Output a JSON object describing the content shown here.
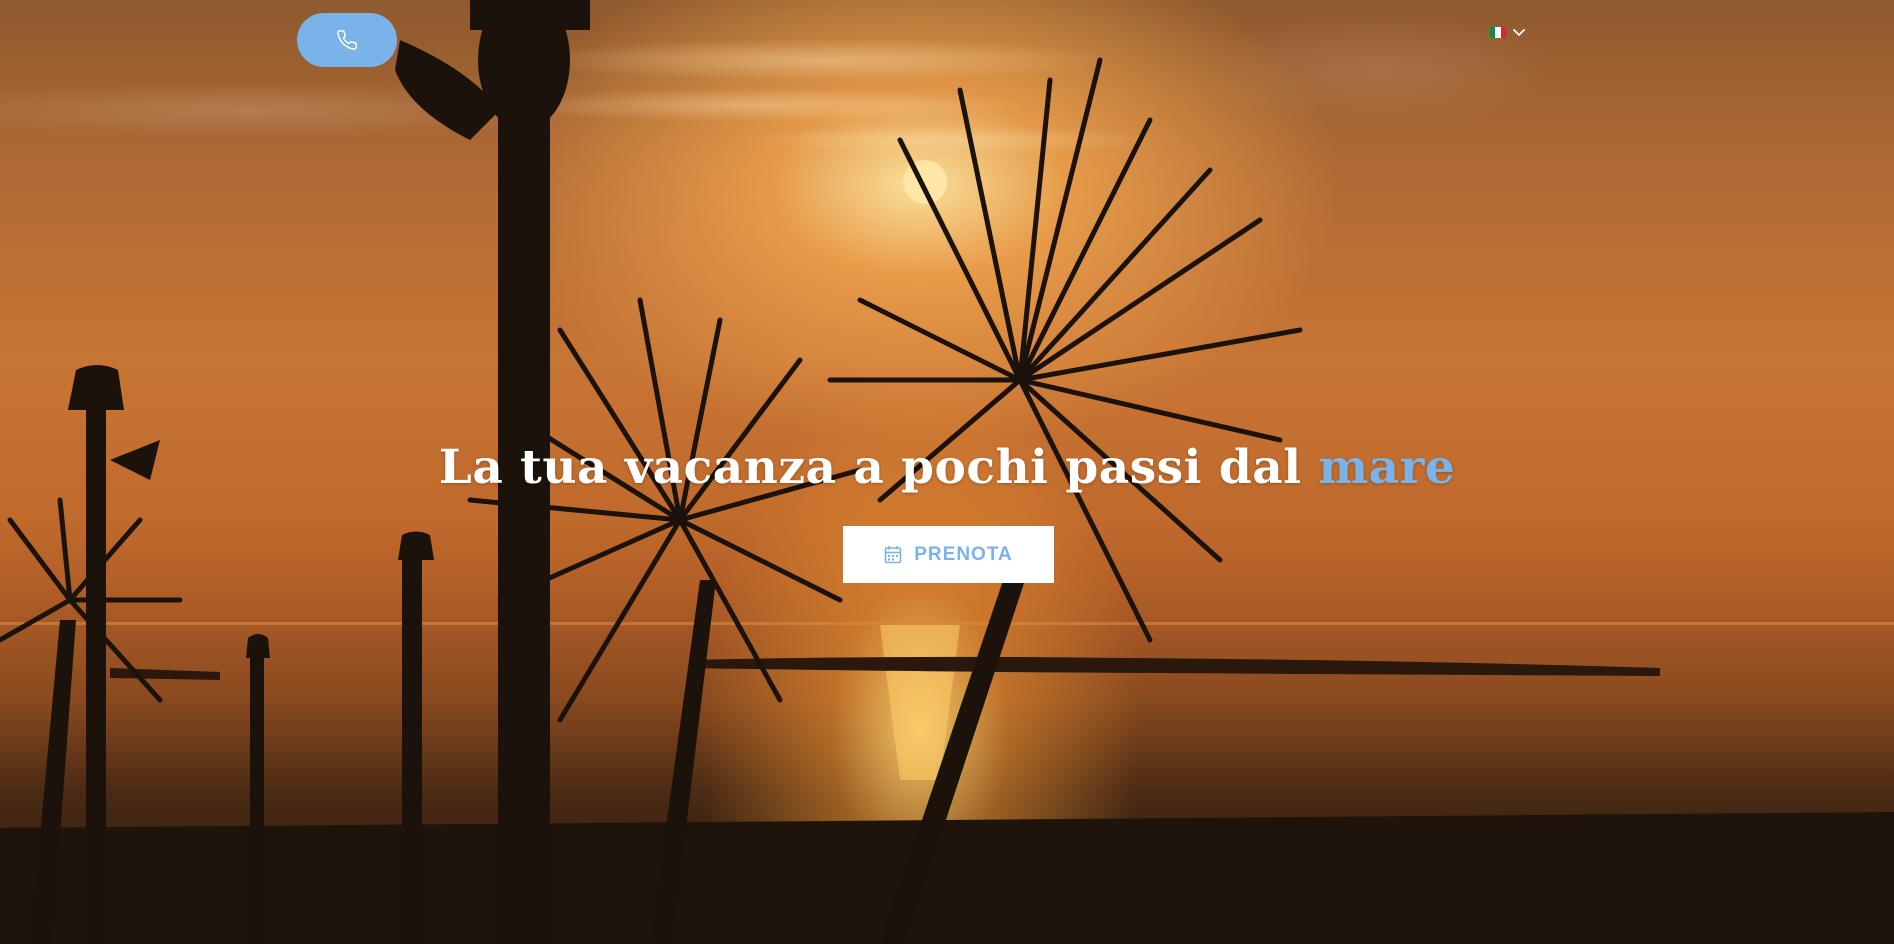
{
  "header": {
    "phone_icon": "phone-icon",
    "language": {
      "flag_icon": "italy-flag-icon",
      "chevron_icon": "chevron-down-icon"
    }
  },
  "hero": {
    "headline_main": "La tua vacanza a pochi passi dal ",
    "headline_accent": "mare",
    "book_button": {
      "icon": "calendar-icon",
      "label": "PRENOTA"
    }
  },
  "colors": {
    "accent": "#7ab3ea",
    "button_bg": "#ffffff",
    "headline": "#ffffff",
    "flag_green": "#009246",
    "flag_white": "#ffffff",
    "flag_red": "#ce2b37"
  }
}
